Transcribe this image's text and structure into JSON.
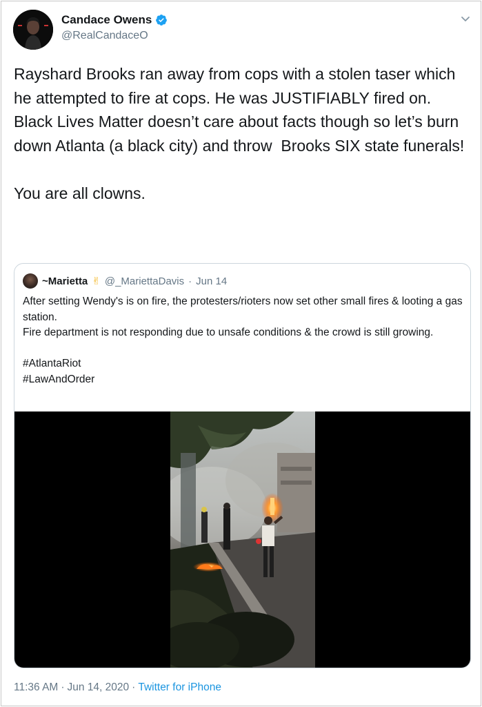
{
  "author": {
    "display_name": "Candace Owens",
    "handle": "@RealCandaceO",
    "verified": true
  },
  "tweet": {
    "text": "Rayshard Brooks ran away from cops with a stolen taser which he attempted to fire at cops. He was JUSTIFIABLY fired on.\nBlack Lives Matter doesn’t care about facts though so let’s burn down Atlanta (a black city) and throw  Brooks SIX state funerals!\n\nYou are all clowns."
  },
  "quoted_tweet": {
    "display_name": "~Marietta",
    "emoji": "✌",
    "handle": "@_MariettaDavis",
    "separator": "·",
    "date": "Jun 14",
    "text": "After setting Wendy's is on fire, the protesters/rioters now set other small fires & looting a gas station.\nFire department is not responding due to unsafe conditions & the crowd is still growing.\n\n#AtlantaRiot\n#LawAndOrder"
  },
  "footer": {
    "time": "11:36 AM",
    "sep1": "·",
    "date": "Jun 14, 2020",
    "sep2": "·",
    "source": "Twitter for iPhone"
  },
  "colors": {
    "link_blue": "#1b95e0",
    "secondary_gray": "#657786",
    "verified_blue": "#1da1f2"
  },
  "icons": [
    "verified-badge-icon",
    "chevron-down-icon"
  ]
}
